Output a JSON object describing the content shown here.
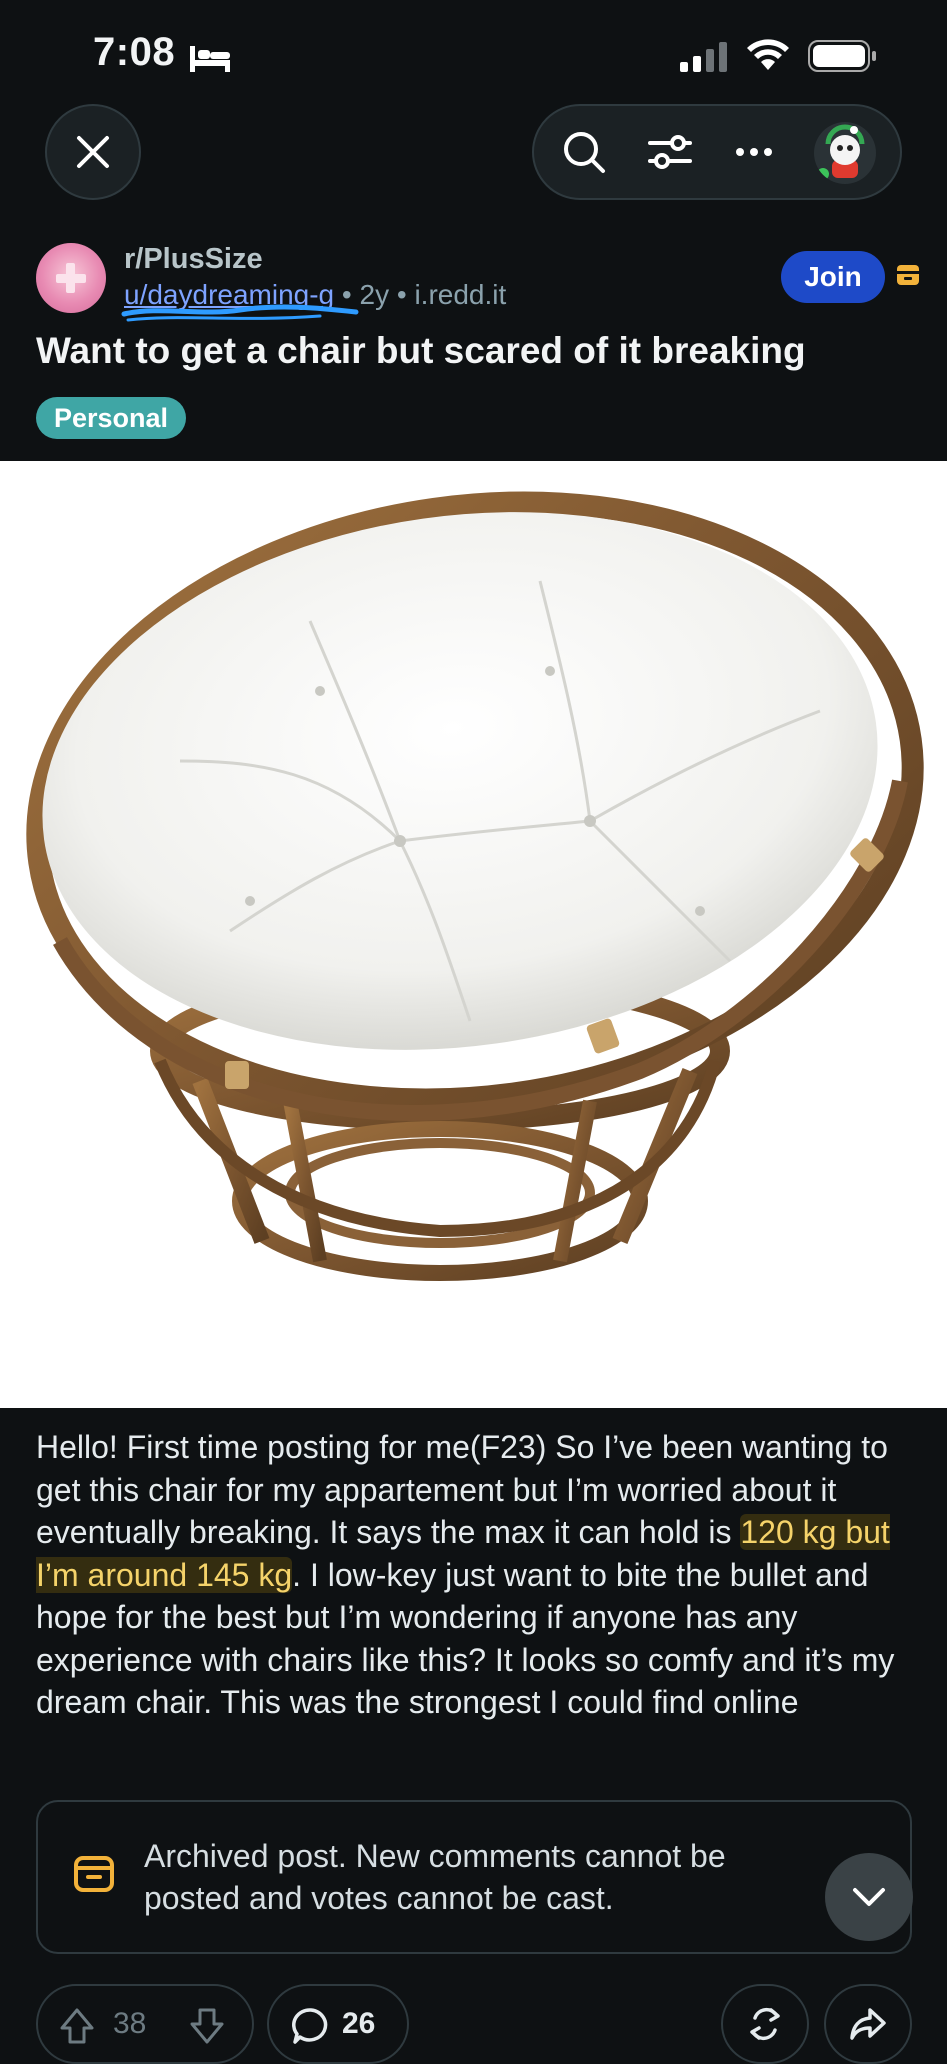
{
  "status_bar": {
    "time": "7:08"
  },
  "post": {
    "subreddit": "r/PlusSize",
    "author": "u/daydreaming-g",
    "age": "2y",
    "domain": "i.redd.it",
    "separator": "•",
    "join_label": "Join",
    "title": "Want to get a chair but scared of it breaking",
    "flair": "Personal",
    "body_part1": "Hello! First time posting for me(F23) So I’ve been wanting to get this chair for my appartement but I’m worried about it eventually breaking. It says the max it can hold is ",
    "body_highlight": "120 kg but I’m around 145 kg",
    "body_part2": ". I low-key just want to bite the bullet and hope for the best but I’m wondering if anyone has any experience with chairs like this? It looks so comfy and it’s my dream chair. This was the strongest I could find online"
  },
  "archived_notice": {
    "text": "Archived post. New comments cannot be posted and votes cannot be cast."
  },
  "actions": {
    "votes": "38",
    "comments": "26"
  },
  "colors": {
    "background": "#0e1113",
    "join": "#1e4ac8",
    "flair": "#3fa6a5",
    "archive_accent": "#f2b23a",
    "link": "#7ea3ff"
  },
  "icons": [
    "close-icon",
    "search-icon",
    "filter-icon",
    "more-icon",
    "user-avatar",
    "archive-icon",
    "chevron-down-icon",
    "upvote-icon",
    "downvote-icon",
    "comment-icon",
    "award-icon",
    "share-icon"
  ]
}
